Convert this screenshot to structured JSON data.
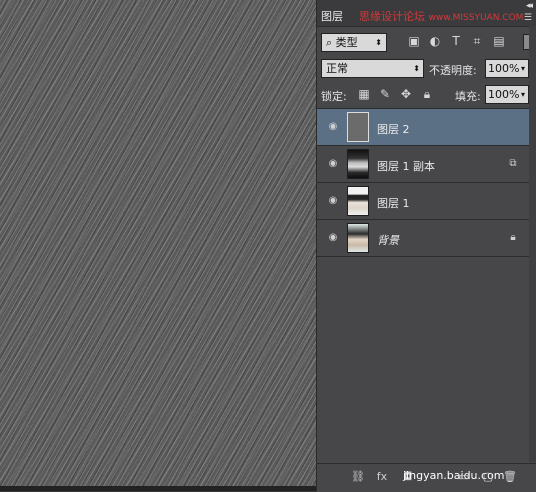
{
  "panel": {
    "tab_label": "图层",
    "watermark_text": "思缘设计论坛",
    "watermark_url": "www.MISSYUAN.COM",
    "filter": {
      "label": "类型",
      "icons": [
        "image-filter-icon",
        "adjust-filter-icon",
        "text-filter-icon",
        "shape-filter-icon",
        "smart-object-filter-icon"
      ]
    },
    "blend_mode": "正常",
    "opacity_label": "不透明度:",
    "opacity_value": "100%",
    "lock_label": "锁定:",
    "fill_label": "填充:",
    "fill_value": "100%"
  },
  "layers": [
    {
      "name": "图层 2",
      "selected": true,
      "thumb": "grey"
    },
    {
      "name": "图层 1 副本",
      "selected": false,
      "thumb": "photo2",
      "badge": "smart-object-icon"
    },
    {
      "name": "图层 1",
      "selected": false,
      "thumb": "photo"
    },
    {
      "name": "背景",
      "selected": false,
      "thumb": "photo3",
      "badge": "lock-icon",
      "italic": true
    }
  ],
  "footer": {
    "watermark": "jingyan.baidu.com",
    "icons": [
      "link-icon",
      "fx-icon",
      "mask-icon",
      "adjustment-icon",
      "group-icon",
      "new-layer-icon",
      "trash-icon"
    ]
  },
  "colors": {
    "selected_row": "#5b6f85",
    "watermark": "#d23b3b",
    "panel_bg": "#474649"
  }
}
